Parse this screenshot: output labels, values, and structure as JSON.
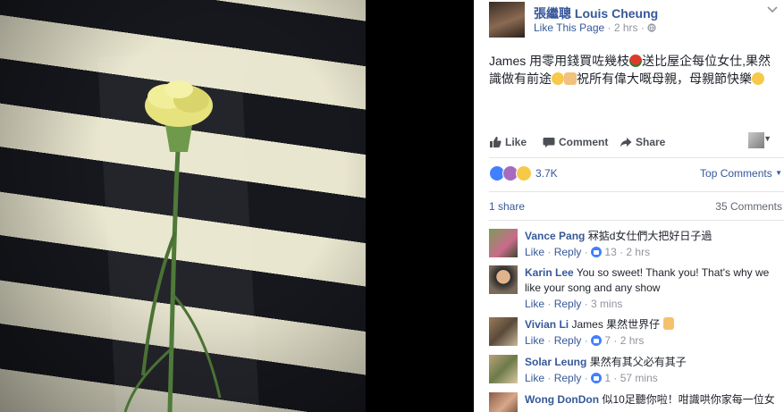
{
  "post": {
    "page_name": "張繼聰 Louis Cheung",
    "like_page": "Like This Page",
    "time": "2 hrs",
    "text_line1": "James 用零用錢買咗幾枝",
    "text_line1_tail": "送比屋企每位女仕,果然",
    "text_line2": "識做有前途",
    "text_line2_tail": "祝所有偉大嘅母親，母親節快樂"
  },
  "actions": {
    "like": "Like",
    "comment": "Comment",
    "share": "Share"
  },
  "reactions": {
    "count": "3.7K",
    "top_comments": "Top Comments"
  },
  "stats": {
    "shares": "1 share",
    "comments": "35 Comments"
  },
  "comments": [
    {
      "name": "Vance Pang",
      "text": "冧掂d女仕們大把好日子過",
      "like": "Like",
      "reply": "Reply",
      "likes": "13",
      "time": "2 hrs"
    },
    {
      "name": "Karin Lee",
      "text": "You so sweet! Thank you! That's why we like your song and any show",
      "like": "Like",
      "reply": "Reply",
      "likes": "",
      "time": "3 mins"
    },
    {
      "name": "Vivian Li",
      "text": "James 果然世界仔",
      "like": "Like",
      "reply": "Reply",
      "likes": "7",
      "time": "2 hrs"
    },
    {
      "name": "Solar Leung",
      "text": "果然有其父必有其子",
      "like": "Like",
      "reply": "Reply",
      "likes": "1",
      "time": "57 mins"
    },
    {
      "name": "Wong DonDon",
      "text": "似10足聽你啦！咁識哄你家每一位女",
      "like": "",
      "reply": "",
      "likes": "",
      "time": ""
    }
  ],
  "colors": {
    "link": "#365899",
    "meta": "#90949c",
    "like_blue": "#4080ff"
  }
}
